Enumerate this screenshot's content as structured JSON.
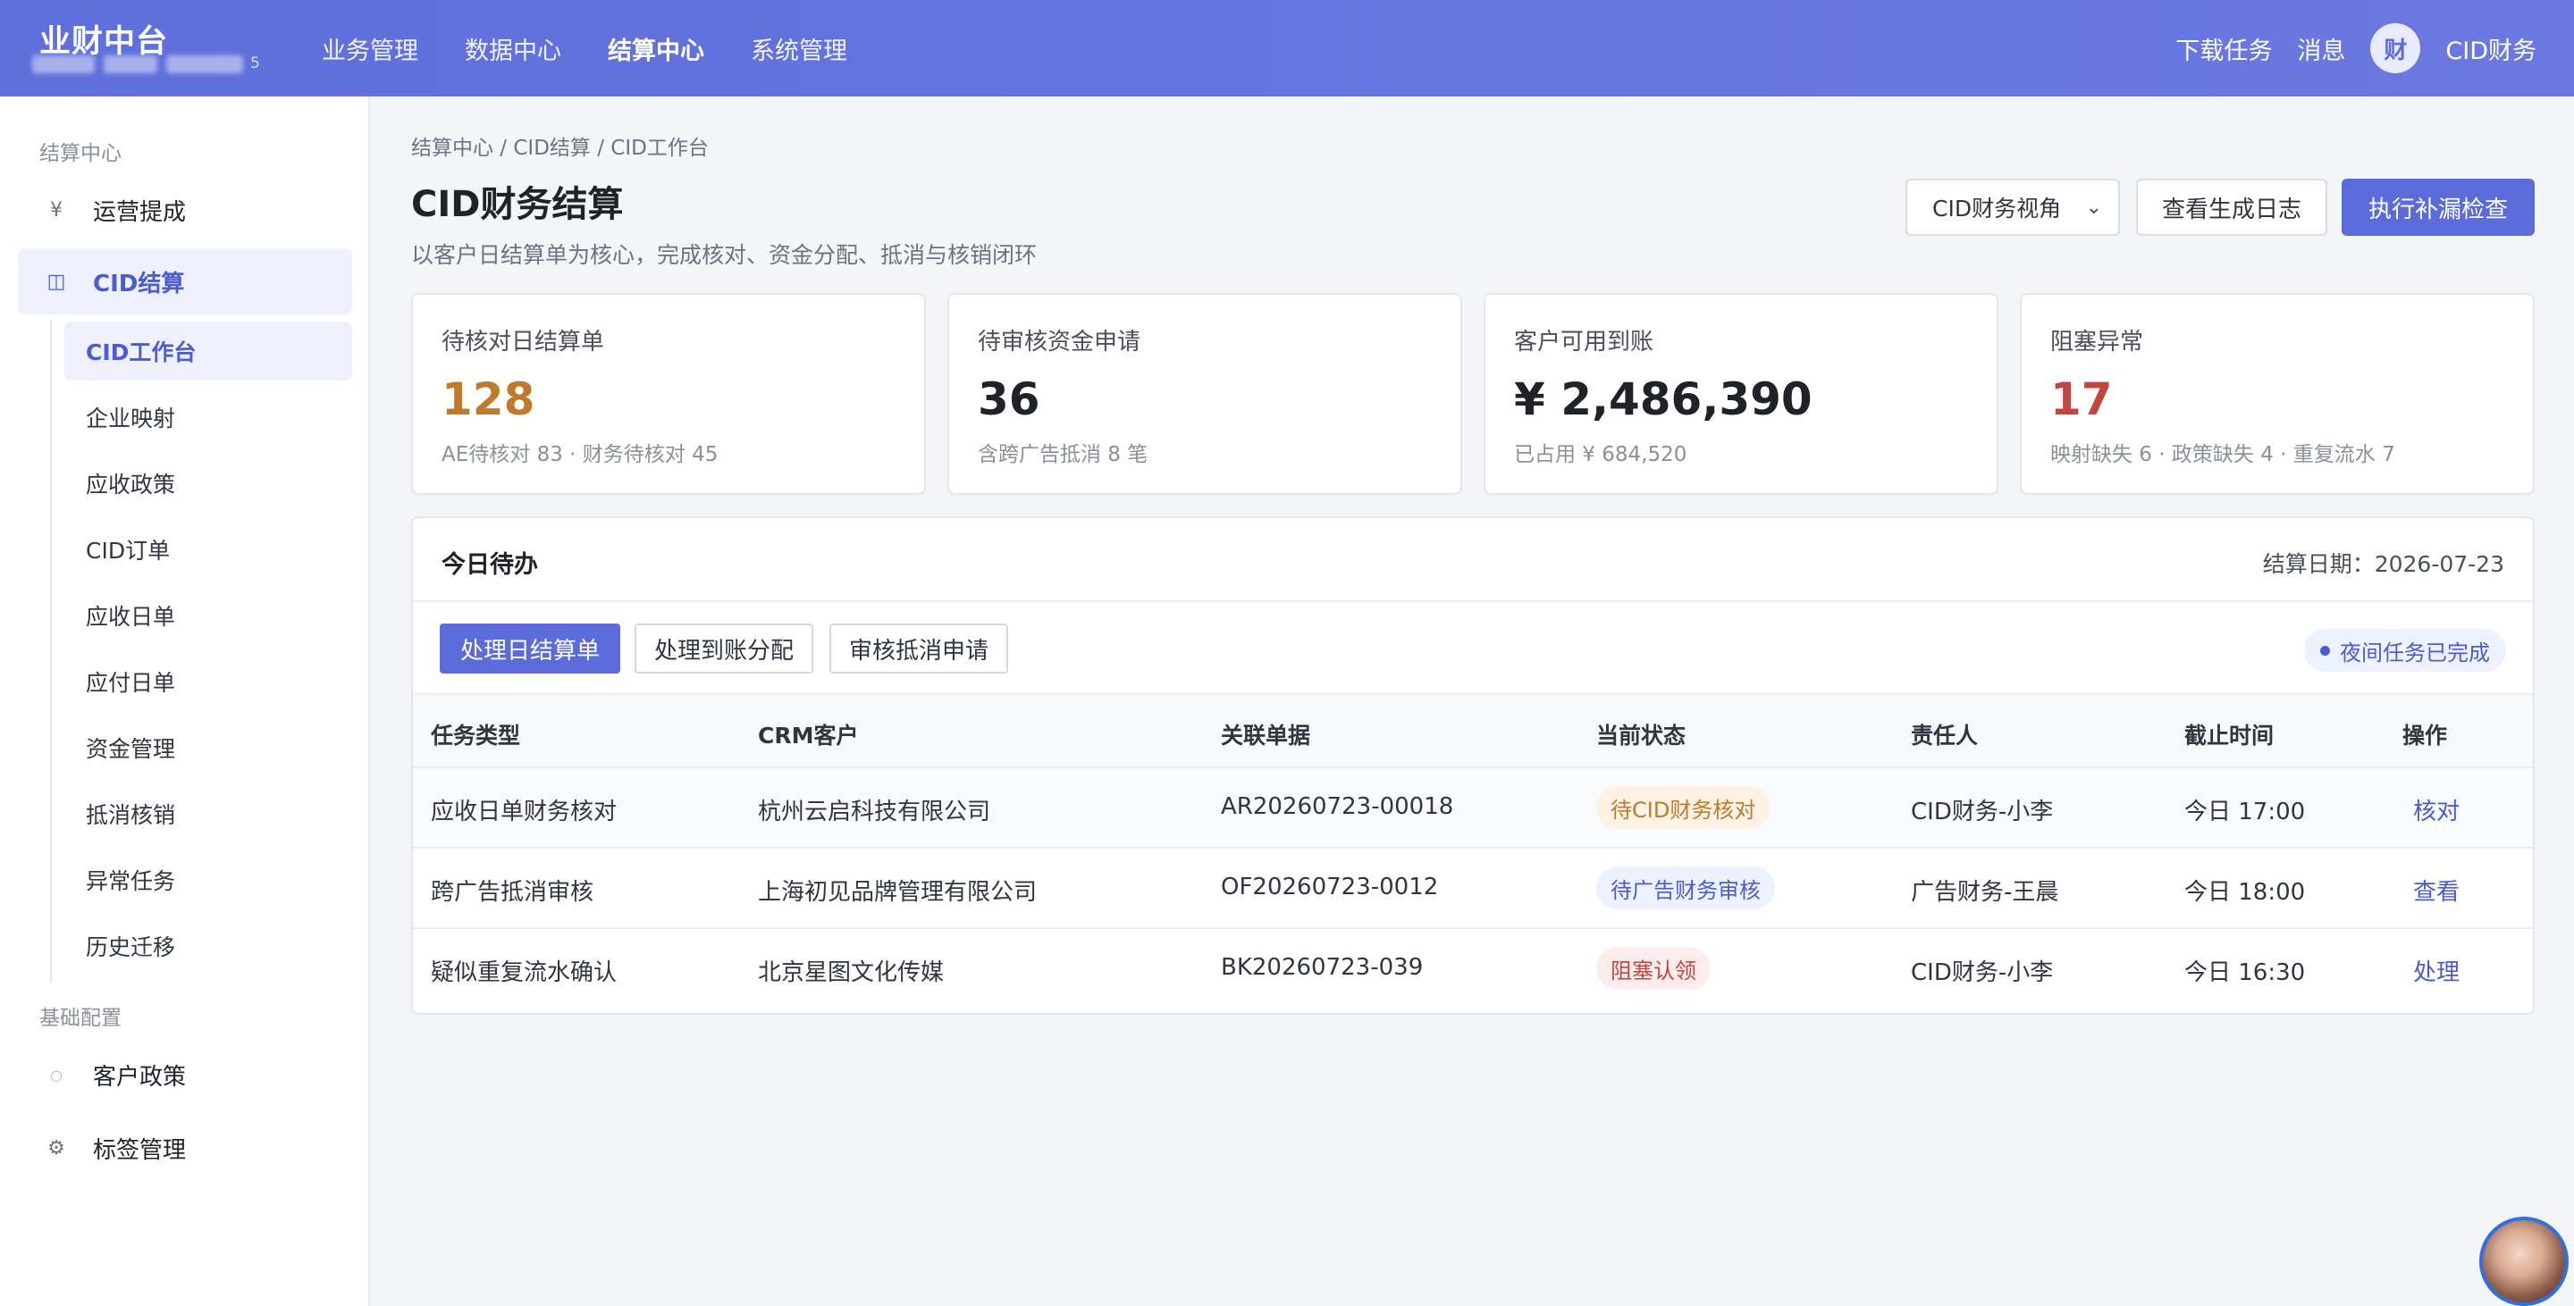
{
  "app": {
    "title": "业财中台",
    "subtitle_tail": "5"
  },
  "topnav": {
    "items": [
      "业务管理",
      "数据中心",
      "结算中心",
      "系统管理"
    ],
    "active": "结算中心"
  },
  "topright": {
    "download": "下载任务",
    "messages": "消息",
    "avatar_char": "财",
    "user": "CID财务"
  },
  "sidebar": {
    "group1": "结算中心",
    "item_ops": "运营提成",
    "item_cid": "CID结算",
    "subitems": [
      "CID工作台",
      "企业映射",
      "应收政策",
      "CID订单",
      "应收日单",
      "应付日单",
      "资金管理",
      "抵消核销",
      "异常任务",
      "历史迁移"
    ],
    "group2": "基础配置",
    "item_customer_policy": "客户政策",
    "item_tags": "标签管理"
  },
  "page": {
    "breadcrumb": "结算中心 / CID结算 / CID工作台",
    "title": "CID财务结算",
    "desc": "以客户日结算单为核心，完成核对、资金分配、抵消与核销闭环",
    "view_select": "CID财务视角",
    "btn_log": "查看生成日志",
    "btn_check": "执行补漏检查"
  },
  "stats": [
    {
      "label": "待核对日结算单",
      "value": "128",
      "sub": "AE待核对 83 · 财务待核对 45",
      "color": "#c07a2c"
    },
    {
      "label": "待审核资金申请",
      "value": "36",
      "sub": "含跨广告抵消 8 笔",
      "color": "#1f2329"
    },
    {
      "label": "客户可用到账",
      "value": "¥ 2,486,390",
      "sub": "已占用 ¥ 684,520",
      "color": "#1f2329"
    },
    {
      "label": "阻塞异常",
      "value": "17",
      "sub": "映射缺失 6 · 政策缺失 4 · 重复流水 7",
      "color": "#c0463f"
    }
  ],
  "todo": {
    "title": "今日待办",
    "date": "结算日期：2026-07-23",
    "tabs": [
      "处理日结算单",
      "处理到账分配",
      "审核抵消申请"
    ],
    "night_status": "夜间任务已完成",
    "columns": [
      "任务类型",
      "CRM客户",
      "关联单据",
      "当前状态",
      "责任人",
      "截止时间",
      "操作"
    ],
    "rows": [
      {
        "type": "应收日单财务核对",
        "customer": "杭州云启科技有限公司",
        "doc": "AR20260723-00018",
        "status": "待CID财务核对",
        "owner": "CID财务-小李",
        "deadline": "今日 17:00",
        "action": "核对"
      },
      {
        "type": "跨广告抵消审核",
        "customer": "上海初见品牌管理有限公司",
        "doc": "OF20260723-0012",
        "status": "待广告财务审核",
        "owner": "广告财务-王晨",
        "deadline": "今日 18:00",
        "action": "查看"
      },
      {
        "type": "疑似重复流水确认",
        "customer": "北京星图文化传媒",
        "doc": "BK20260723-039",
        "status": "阻塞认领",
        "owner": "CID财务-小李",
        "deadline": "今日 16:30",
        "action": "处理"
      }
    ]
  },
  "colors": {
    "primary": "#5b6bd9",
    "status_warn_bg": "#fdf2e3",
    "status_warn_fg": "#c07a2c",
    "status_info_bg": "#eef1ff",
    "status_info_fg": "#4b5bd1",
    "status_error_bg": "#fdecec",
    "status_error_fg": "#c0463f"
  }
}
